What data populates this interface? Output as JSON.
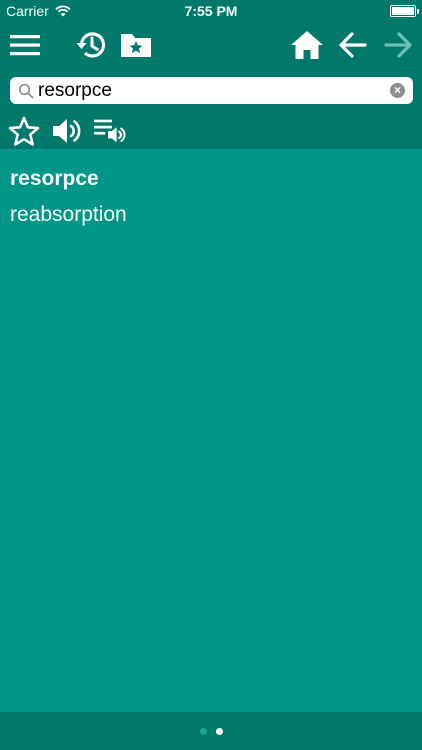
{
  "status_bar": {
    "carrier": "Carrier",
    "time": "7:55 PM"
  },
  "toolbar": {
    "icons": [
      "menu-icon",
      "history-icon",
      "favorites-folder-icon",
      "home-icon",
      "back-arrow-icon",
      "forward-arrow-icon"
    ]
  },
  "search": {
    "value": "resorpce",
    "placeholder": ""
  },
  "actions": {
    "icons": [
      "star-icon",
      "speaker-icon",
      "playlist-audio-icon"
    ]
  },
  "result": {
    "word": "resorpce",
    "translation": "reabsorption"
  },
  "pager": {
    "pages": 2,
    "active": 2
  },
  "colors": {
    "header": "#00796b",
    "background": "#009688",
    "text": "#ffffff",
    "disabled_icon": "#6fbfb5"
  }
}
